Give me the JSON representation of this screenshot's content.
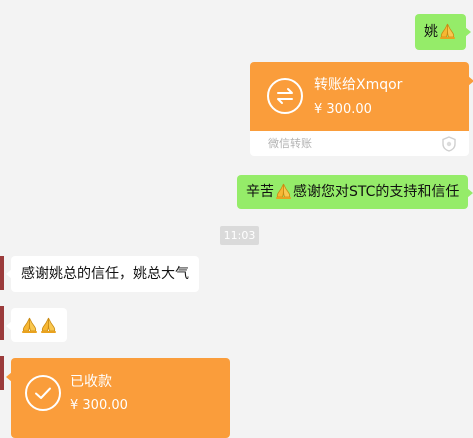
{
  "messages": {
    "m1": {
      "text": "姚",
      "emoji": "folded-hands-icon"
    },
    "transfer_sent": {
      "title": "转账给Xmqor",
      "amount": "¥ 300.00",
      "footer": "微信转账",
      "icon": "transfer-arrows-icon",
      "color": "#fa9d3b"
    },
    "m2": {
      "prefix": "辛苦",
      "emoji": "folded-hands-icon",
      "suffix": "感谢您对STC的支持和信任"
    },
    "timestamp": "11:03",
    "m3": {
      "text": "感谢姚总的信任，姚总大气"
    },
    "m4": {
      "emoji": "folded-hands-icon",
      "count": 2
    },
    "transfer_received": {
      "title": "已收款",
      "amount": "¥ 300.00",
      "icon": "check-circle-icon",
      "color": "#fa9d3b"
    }
  },
  "colors": {
    "background": "#f3f3f3",
    "self_bubble": "#95ec69",
    "other_bubble": "#ffffff",
    "transfer": "#fa9d3b",
    "timestamp_bg": "#dadada"
  }
}
